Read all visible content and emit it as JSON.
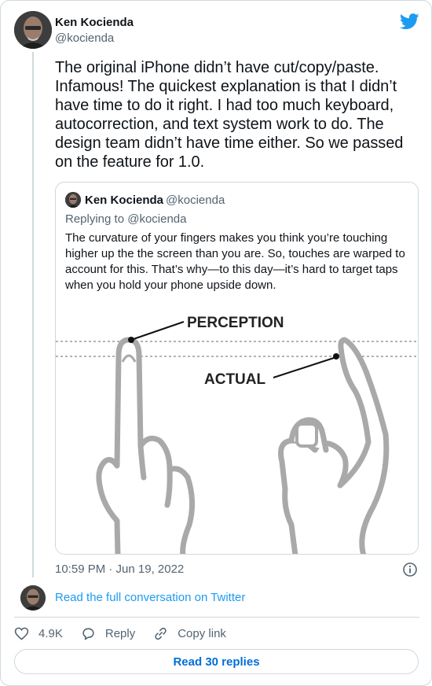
{
  "tweet": {
    "author_name": "Ken Kocienda",
    "author_handle": "@kocienda",
    "text": "The original iPhone didn’t have cut/copy/paste. Infamous! The quickest explanation is that I didn’t have time to do it right. I had too much keyboard, autocorrection, and text system work to do. The design team didn’t have time either. So we passed on the feature for 1.0.",
    "timestamp": "10:59 PM · Jun 19, 2022",
    "brand_color": "#1d9bf0"
  },
  "quoted": {
    "author_name": "Ken Kocienda",
    "author_handle": "@kocienda",
    "replying_to": "Replying to @kocienda",
    "text": "The curvature of your fingers makes you think you’re touching higher up the the screen than you are. So, touches are warped to account for this. That’s why—to this day—it’s hard to target taps when you hold your phone upside down.",
    "image": {
      "label_perception": "PERCEPTION",
      "label_actual": "ACTUAL"
    }
  },
  "conversation": {
    "link": "Read the full conversation on Twitter"
  },
  "actions": {
    "like_count": "4.9K",
    "reply_label": "Reply",
    "copy_link_label": "Copy link"
  },
  "replies_button": "Read 30 replies",
  "icons": {
    "brand": "twitter-bird-icon",
    "info": "info-icon",
    "like": "heart-icon",
    "reply": "reply-bubble-icon",
    "copy": "link-icon"
  }
}
